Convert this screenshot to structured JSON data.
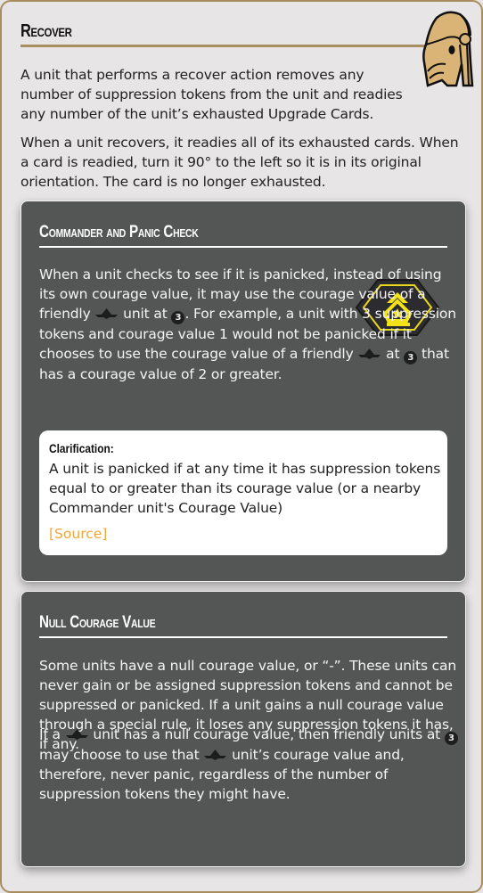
{
  "recover": {
    "title": "Recover",
    "paragraph_1": "A unit that performs a recover action removes any number of suppression tokens from the unit and readies any number of the unit’s exhausted Upgrade Cards.",
    "paragraph_2": "When a unit recovers, it readies all of its exhausted cards. When a card is readied, turn it 90° to the left so it is in its original orientation. The card is no longer exhausted.",
    "icon": "battle-droid-icon"
  },
  "commander_panic": {
    "title": "Commander and Panic Check",
    "icon": "commander-rank-badge-icon",
    "text": {
      "s1": "When a unit checks to see if it is panicked, instead of using its own courage value, it may use the courage value of a friendly ",
      "s2": " unit at ",
      "s3": ". For example, a unit with 3 suppression tokens and courage value 1 would not be panicked if it chooses to use the courage value of a friendly ",
      "s4": " at ",
      "s5": " that has a courage value of 2 or greater."
    },
    "range_label": "3",
    "clarification": {
      "heading": "Clarification:",
      "text": "A unit is panicked if at any time it has suppression tokens equal to or greater than its courage value (or a nearby Commander unit's Courage Value)",
      "source_link": "[Source]"
    }
  },
  "null_courage": {
    "title": "Null Courage Value",
    "paragraph_1": "Some units have a null courage value, or “-”. These units can never gain or be assigned suppression tokens and cannot be suppressed or panicked. If a unit gains a null courage value through a special rule, it loses any suppression tokens it has, if any.",
    "paragraph_2": {
      "s1": "If a ",
      "s2": " unit has a null courage value, then friendly units at ",
      "s3": " may choose to use that ",
      "s4": " unit’s courage value and, therefore, never panic, regardless of the number of suppression tokens they might have."
    },
    "range_label": "3"
  },
  "colors": {
    "accent_gold": "#a88d5e",
    "card_bg": "#545555",
    "source_link": "#f0a73a",
    "badge_yellow": "#f2e21a"
  }
}
